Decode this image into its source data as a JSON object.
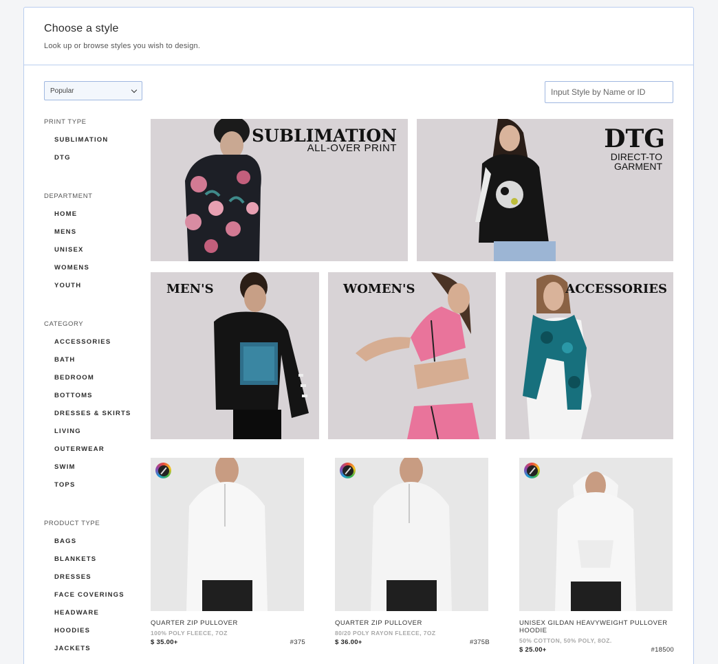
{
  "header": {
    "title": "Choose a style",
    "subtitle": "Look up or browse styles you wish to design."
  },
  "sort": {
    "selected": "Popular"
  },
  "search": {
    "placeholder": "Input Style by Name or ID"
  },
  "sidebar": {
    "groups": [
      {
        "title": "PRINT TYPE",
        "items": [
          "SUBLIMATION",
          "DTG"
        ]
      },
      {
        "title": "DEPARTMENT",
        "items": [
          "HOME",
          "MENS",
          "UNISEX",
          "WOMENS",
          "YOUTH"
        ]
      },
      {
        "title": "CATEGORY",
        "items": [
          "ACCESSORIES",
          "BATH",
          "BEDROOM",
          "BOTTOMS",
          "DRESSES & SKIRTS",
          "LIVING",
          "OUTERWEAR",
          "SWIM",
          "TOPS"
        ]
      },
      {
        "title": "PRODUCT TYPE",
        "items": [
          "BAGS",
          "BLANKETS",
          "DRESSES",
          "FACE COVERINGS",
          "HEADWARE",
          "HOODIES",
          "JACKETS"
        ]
      }
    ]
  },
  "banners": {
    "sublimation": {
      "title": "SUBLIMATION",
      "sub": "ALL-OVER PRINT"
    },
    "dtg": {
      "title": "DTG",
      "sub1": "DIRECT-TO",
      "sub2": "GARMENT"
    },
    "mens": {
      "title": "MEN'S"
    },
    "womens": {
      "title": "WOMEN'S"
    },
    "accessories": {
      "title": "ACCESSORIES"
    }
  },
  "products": [
    {
      "name": "QUARTER ZIP PULLOVER",
      "material": "100% POLY FLEECE, 7OZ",
      "price": "$ 35.00+",
      "id": "#375"
    },
    {
      "name": "QUARTER ZIP PULLOVER",
      "material": "80/20 POLY RAYON FLEECE, 7OZ",
      "price": "$ 36.00+",
      "id": "#375B"
    },
    {
      "name": "UNISEX GILDAN HEAVYWEIGHT PULLOVER HOODIE",
      "material": "50% COTTON, 50% POLY, 8OZ.",
      "price": "$ 25.00+",
      "id": "#18500"
    }
  ],
  "colors": {
    "accent_border": "#b9cdef",
    "banner_bg": "#d8d3d6"
  }
}
